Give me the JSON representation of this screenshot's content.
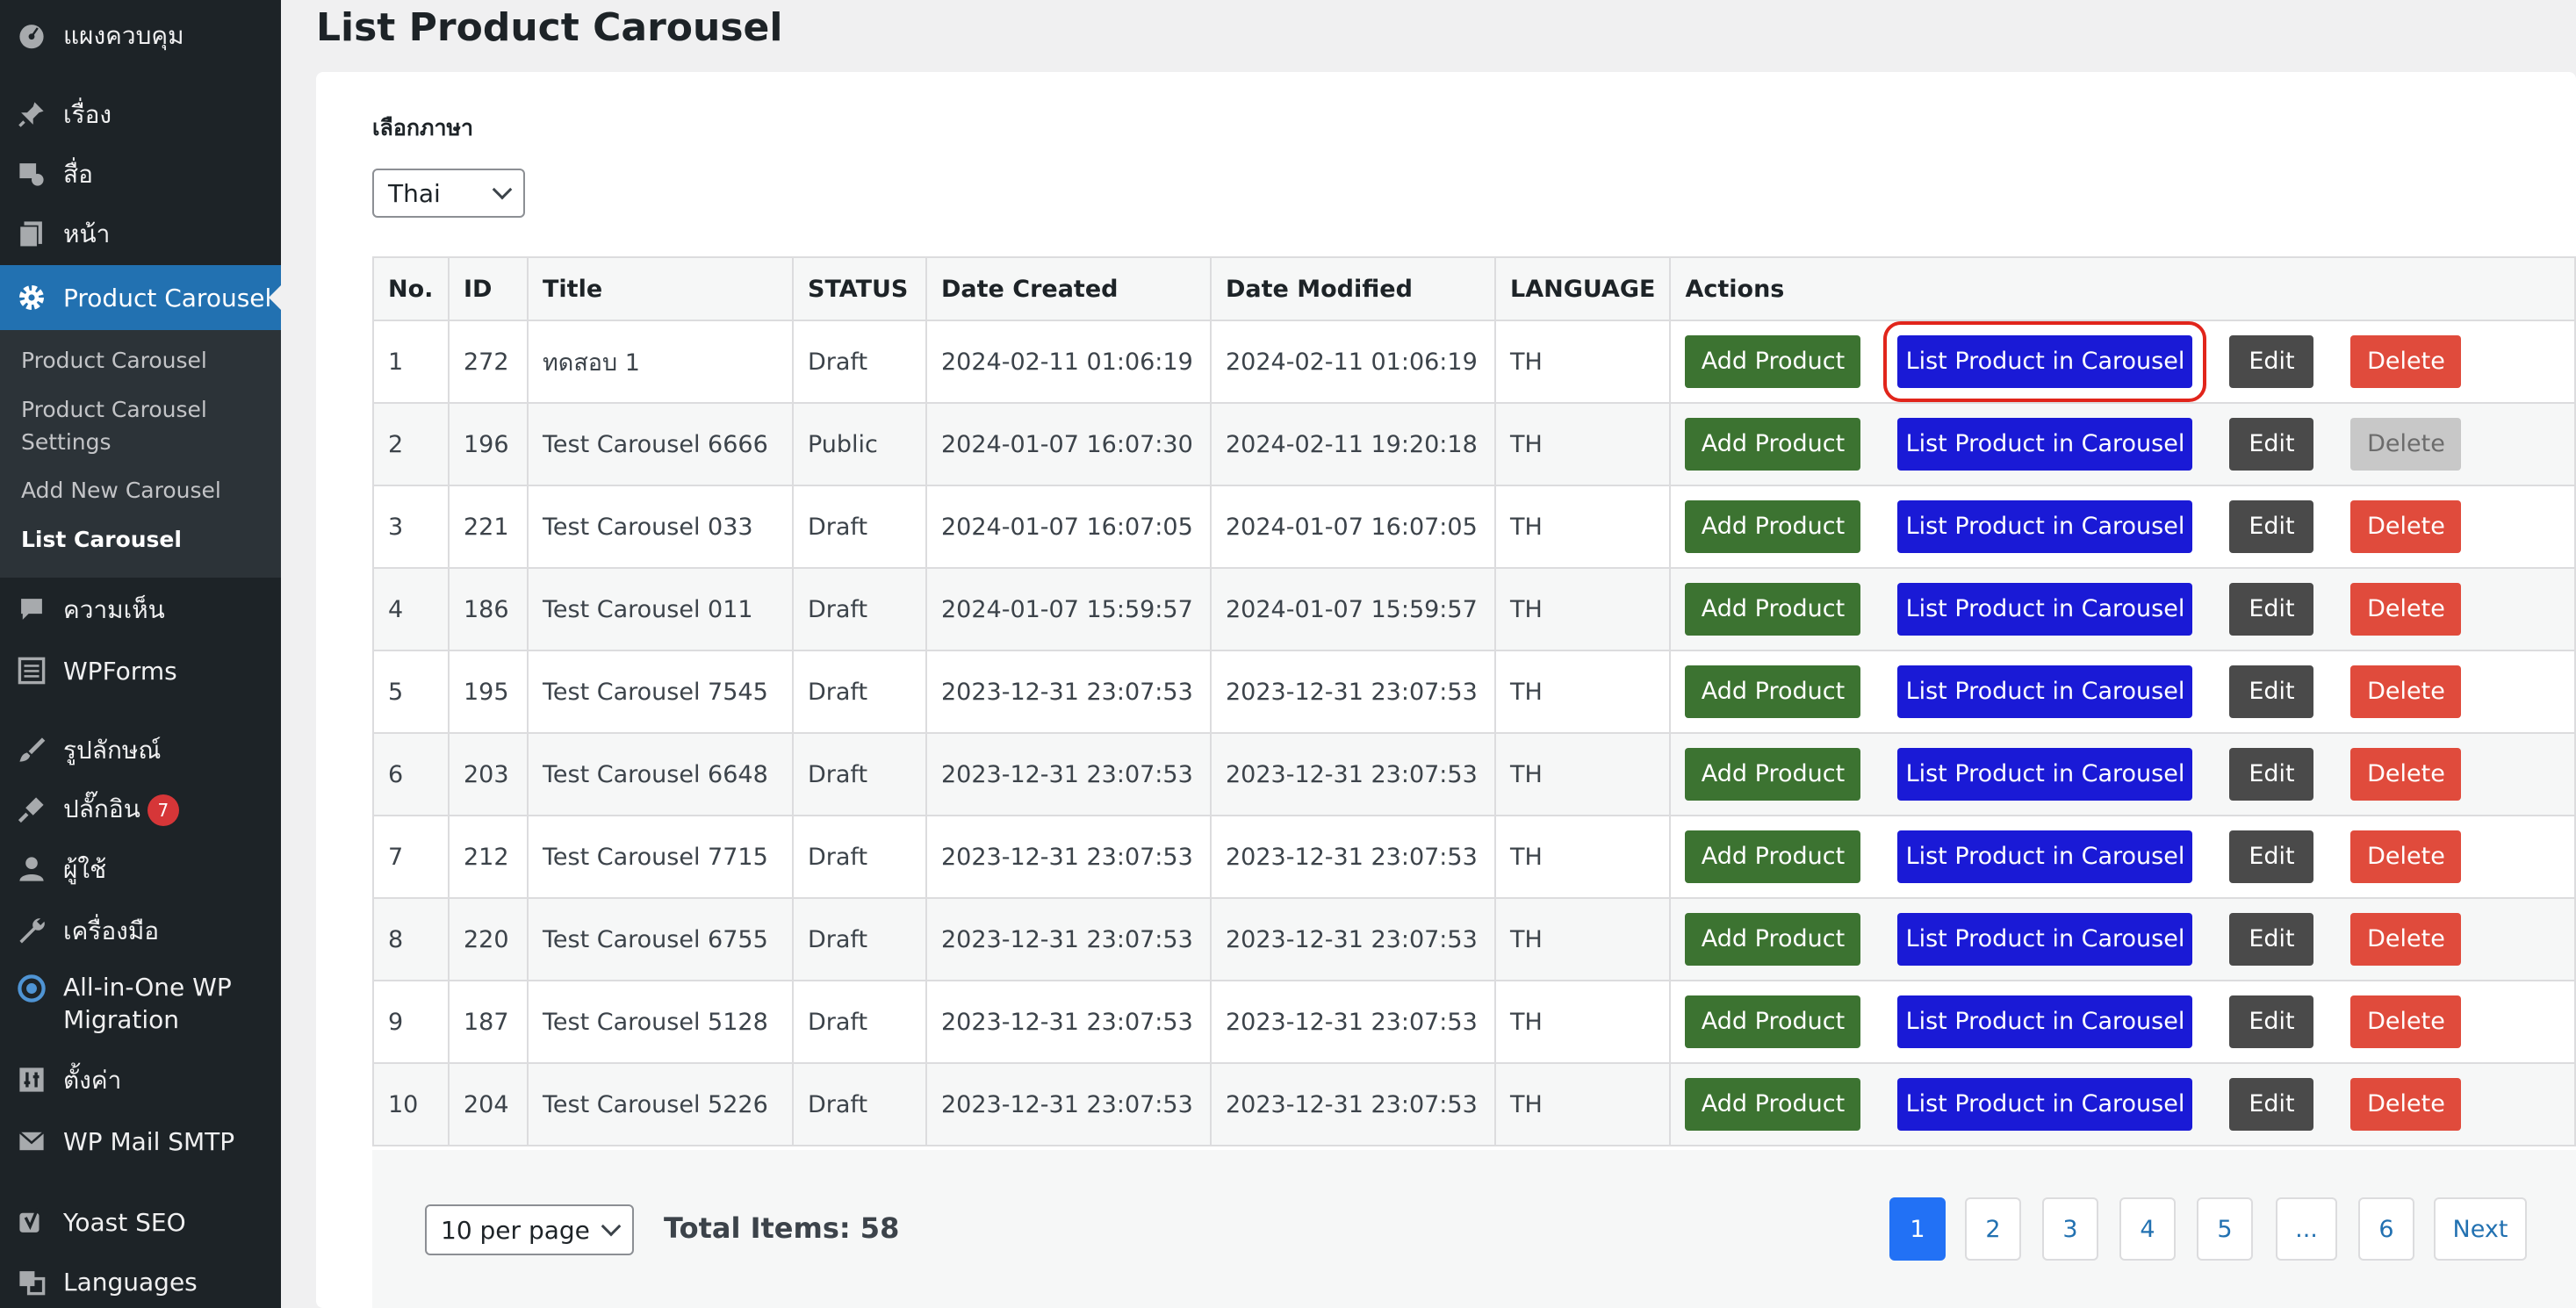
{
  "sidebar": {
    "items": [
      {
        "label": "แผงควบคุม",
        "icon": "dashboard-icon"
      },
      {
        "label": "เรื่อง",
        "icon": "pin-icon"
      },
      {
        "label": "สื่อ",
        "icon": "media-icon"
      },
      {
        "label": "หน้า",
        "icon": "page-icon"
      },
      {
        "label": "Product Carousel",
        "icon": "gear-icon"
      },
      {
        "label": "ความเห็น",
        "icon": "comment-icon"
      },
      {
        "label": "WPForms",
        "icon": "forms-icon"
      },
      {
        "label": "รูปลักษณ์",
        "icon": "brush-icon"
      },
      {
        "label": "ปลั๊กอิน",
        "icon": "plugin-icon",
        "badge": "7"
      },
      {
        "label": "ผู้ใช้",
        "icon": "user-icon"
      },
      {
        "label": "เครื่องมือ",
        "icon": "wrench-icon"
      },
      {
        "label": "All-in-One WP Migration",
        "icon": "migration-icon"
      },
      {
        "label": "ตั้งค่า",
        "icon": "settings-icon"
      },
      {
        "label": "WP Mail SMTP",
        "icon": "mail-icon"
      },
      {
        "label": "Yoast SEO",
        "icon": "yoast-icon"
      },
      {
        "label": "Languages",
        "icon": "languages-icon"
      }
    ],
    "submenu": [
      "Product Carousel",
      "Product Carousel Settings",
      "Add New Carousel",
      "List Carousel"
    ]
  },
  "page": {
    "title": "List Product Carousel",
    "language_label": "เลือกภาษา",
    "language_value": "Thai"
  },
  "table": {
    "headers": [
      "No.",
      "ID",
      "Title",
      "STATUS",
      "Date Created",
      "Date Modified",
      "LANGUAGE",
      "Actions"
    ],
    "buttons": {
      "add": "Add Product",
      "list": "List Product in Carousel",
      "edit": "Edit",
      "delete": "Delete"
    },
    "rows": [
      [
        "1",
        "272",
        "ทดสอบ 1",
        "Draft",
        "2024-02-11 01:06:19",
        "2024-02-11 01:06:19",
        "TH"
      ],
      [
        "2",
        "196",
        "Test Carousel 6666",
        "Public",
        "2024-01-07 16:07:30",
        "2024-02-11 19:20:18",
        "TH"
      ],
      [
        "3",
        "221",
        "Test Carousel 033",
        "Draft",
        "2024-01-07 16:07:05",
        "2024-01-07 16:07:05",
        "TH"
      ],
      [
        "4",
        "186",
        "Test Carousel 011",
        "Draft",
        "2024-01-07 15:59:57",
        "2024-01-07 15:59:57",
        "TH"
      ],
      [
        "5",
        "195",
        "Test Carousel 7545",
        "Draft",
        "2023-12-31 23:07:53",
        "2023-12-31 23:07:53",
        "TH"
      ],
      [
        "6",
        "203",
        "Test Carousel 6648",
        "Draft",
        "2023-12-31 23:07:53",
        "2023-12-31 23:07:53",
        "TH"
      ],
      [
        "7",
        "212",
        "Test Carousel 7715",
        "Draft",
        "2023-12-31 23:07:53",
        "2023-12-31 23:07:53",
        "TH"
      ],
      [
        "8",
        "220",
        "Test Carousel 6755",
        "Draft",
        "2023-12-31 23:07:53",
        "2023-12-31 23:07:53",
        "TH"
      ],
      [
        "9",
        "187",
        "Test Carousel 5128",
        "Draft",
        "2023-12-31 23:07:53",
        "2023-12-31 23:07:53",
        "TH"
      ],
      [
        "10",
        "204",
        "Test Carousel 5226",
        "Draft",
        "2023-12-31 23:07:53",
        "2023-12-31 23:07:53",
        "TH"
      ]
    ]
  },
  "footer": {
    "per_page": "10 per page",
    "total": "Total Items: 58",
    "pages": [
      "1",
      "2",
      "3",
      "4",
      "5",
      "...",
      "6"
    ],
    "next": "Next"
  },
  "colors": {
    "sidebar": "#1d2327",
    "active_menu": "#2271b1",
    "add_button": "#3c7331",
    "list_button": "#1a1ad6",
    "edit_button": "#4a4a4a",
    "delete_button": "#e04b3c",
    "highlight": "#e1251b"
  }
}
